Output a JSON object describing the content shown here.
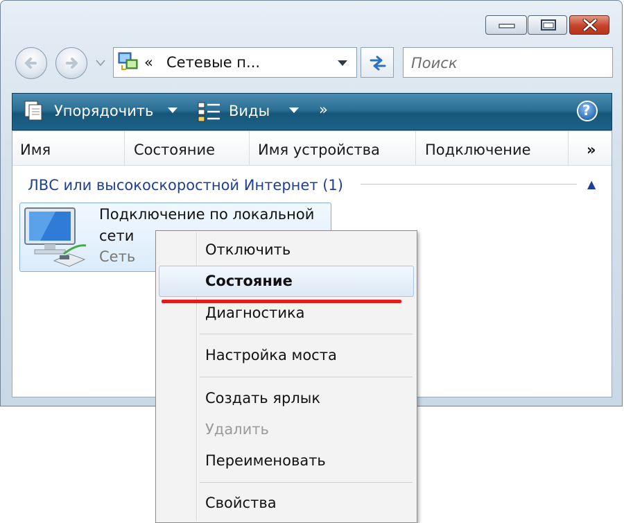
{
  "window": {
    "caption_buttons": [
      "minimize-icon",
      "maximize-icon",
      "close-icon"
    ]
  },
  "address": {
    "prefix": "«",
    "path": "Сетевые п...",
    "search_placeholder": "Поиск"
  },
  "toolbar": {
    "organize_label": "Упорядочить",
    "views_label": "Виды",
    "more_label": "»",
    "help_label": "?"
  },
  "columns": {
    "headers": [
      "Имя",
      "Состояние",
      "Имя устройства",
      "Подключение"
    ],
    "more": "»"
  },
  "group": {
    "title": "ЛВС или высокоскоростной Интернет (1)",
    "collapse": "▲"
  },
  "item": {
    "name_line1": "Подключение по локальной",
    "name_line2": "сети",
    "subtitle": "Сеть"
  },
  "context_menu": {
    "items": [
      {
        "label": "Отключить",
        "state": "normal"
      },
      {
        "label": "Состояние",
        "state": "default-highlighted"
      },
      {
        "label": "Диагностика",
        "state": "normal"
      },
      {
        "label": "Настройка моста",
        "state": "normal"
      },
      {
        "label": "Создать ярлык",
        "state": "normal"
      },
      {
        "label": "Удалить",
        "state": "disabled"
      },
      {
        "label": "Переименовать",
        "state": "normal"
      },
      {
        "label": "Свойства",
        "state": "normal"
      }
    ]
  },
  "colors": {
    "command_bar": "#1d6388",
    "group_title": "#1e3f99",
    "highlight_border": "#a8c5ea",
    "annotation_underline": "#e41b17"
  }
}
